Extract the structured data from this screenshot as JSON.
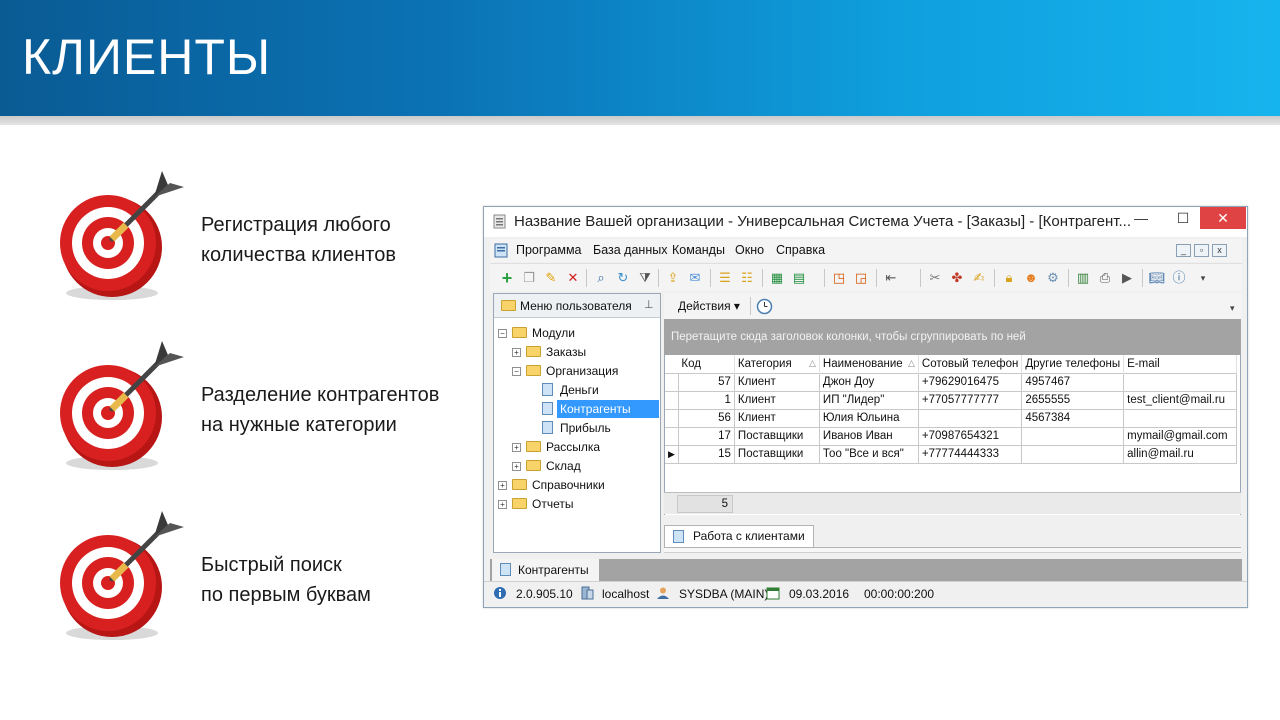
{
  "slide": {
    "title": "КЛИЕНТЫ",
    "features": [
      {
        "line1": "Регистрация любого",
        "line2": "количества клиентов"
      },
      {
        "line1": "Разделение контрагентов",
        "line2": "на нужные категории"
      },
      {
        "line1": "Быстрый поиск",
        "line2": "по первым буквам"
      }
    ],
    "target_colors": {
      "red": "#d21e1e",
      "white": "#ffffff",
      "dart": "#3a3a3a"
    }
  },
  "window": {
    "title": "Название Вашей организации - Универсальная Система Учета - [Заказы] - [Контрагент...",
    "minimize": "—",
    "maximize": "☐",
    "close": "✕",
    "menu": [
      "Программа",
      "База данных",
      "Команды",
      "Окно",
      "Справка"
    ],
    "tree": {
      "header": "Меню пользователя",
      "nodes": [
        "Модули",
        "Заказы",
        "Организация",
        "Деньги",
        "Контрагенты",
        "Прибыль",
        "Рассылка",
        "Склад",
        "Справочники",
        "Отчеты"
      ],
      "selected": "Контрагенты"
    },
    "actions_label": "Действия",
    "group_hint": "Перетащите сюда заголовок колонки, чтобы сгруппировать по ней",
    "grid": {
      "columns": [
        "Код",
        "Категория",
        "Наименование",
        "Сотовый телефон",
        "Другие телефоны",
        "E-mail"
      ],
      "rows": [
        [
          "57",
          "Клиент",
          "Джон Доу",
          "+79629016475",
          "4957467",
          ""
        ],
        [
          "1",
          "Клиент",
          "ИП \"Лидер\"",
          "+77057777777",
          "2655555",
          "test_client@mail.ru"
        ],
        [
          "56",
          "Клиент",
          "Юлия Юльина",
          "",
          "4567384",
          ""
        ],
        [
          "17",
          "Поставщики",
          "Иванов Иван",
          "+70987654321",
          "",
          "mymail@gmail.com"
        ],
        [
          "15",
          "Поставщики",
          "Тоо \"Все и вся\"",
          "+77774444333",
          "",
          "allin@mail.ru"
        ]
      ],
      "count": "5"
    },
    "inner_tab": "Работа с клиентами",
    "bottom_tab": "Контрагенты",
    "status": {
      "version": "2.0.905.10",
      "host": "localhost",
      "user": "SYSDBA (MAIN)",
      "date": "09.03.2016",
      "timer": "00:00:00:200"
    }
  }
}
